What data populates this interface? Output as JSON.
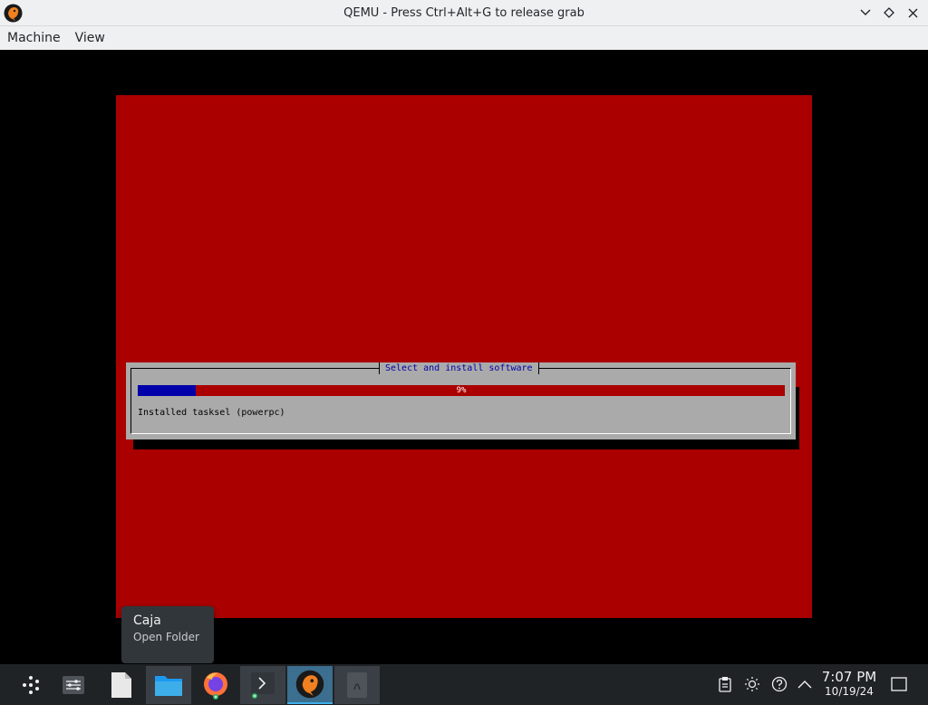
{
  "window": {
    "title": "QEMU - Press Ctrl+Alt+G to release grab",
    "icon": "qemu-icon",
    "controls": [
      "minimize-icon",
      "maximize-icon",
      "close-icon"
    ]
  },
  "menubar": {
    "items": [
      "Machine",
      "View"
    ]
  },
  "installer": {
    "dialog_title": "Select and install software",
    "progress_percent": 9,
    "progress_label": "9%",
    "status": "Installed tasksel (powerpc)",
    "colors": {
      "background": "#aa0000",
      "dialog": "#aaaaaa",
      "progress_fill": "#0000aa",
      "title_text": "#0000aa"
    }
  },
  "tooltip": {
    "title": "Caja",
    "subtitle": "Open Folder"
  },
  "taskbar": {
    "items": [
      {
        "icon": "app-launcher-icon"
      },
      {
        "icon": "task-manager-icon"
      },
      {
        "icon": "text-file-icon"
      },
      {
        "icon": "folder-icon"
      },
      {
        "icon": "firefox-icon"
      },
      {
        "icon": "terminal-icon"
      },
      {
        "icon": "qemu-icon"
      },
      {
        "icon": "document-viewer-icon"
      }
    ],
    "tray": [
      "clipboard-icon",
      "brightness-icon",
      "help-icon",
      "chevron-up-icon"
    ],
    "time": "7:07 PM",
    "date": "10/19/24",
    "show_desktop_icon": "show-desktop-icon"
  }
}
